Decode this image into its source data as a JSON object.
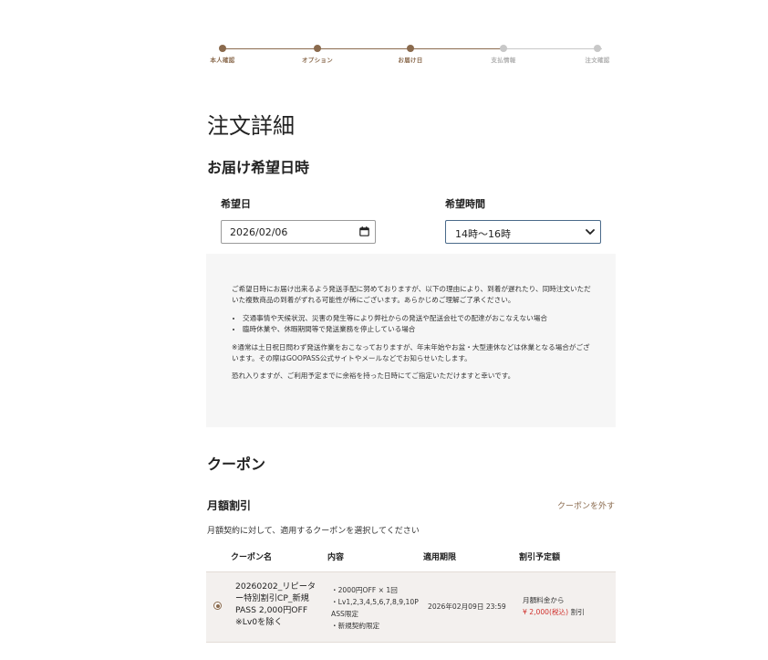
{
  "stepper": {
    "steps": [
      {
        "label": "本人確認",
        "done": true
      },
      {
        "label": "オプション",
        "done": true
      },
      {
        "label": "お届け日",
        "done": true
      },
      {
        "label": "支払情報",
        "done": false
      },
      {
        "label": "注文確認",
        "done": false
      }
    ]
  },
  "page_title": "注文詳細",
  "delivery": {
    "title": "お届け希望日時",
    "date_label": "希望日",
    "date_value": "2026/02/06",
    "time_label": "希望時間",
    "time_value": "14時〜16時"
  },
  "notice": {
    "para1": "ご希望日時にお届け出来るよう発送手配に努めておりますが、以下の理由により、到着が遅れたり、同時注文いただいた複数商品の到着がずれる可能性が稀にございます。あらかじめご理解ご了承ください。",
    "bullets": [
      "交通事情や天候状況、災害の発生等により弊社からの発送や配送会社での配達がおこなえない場合",
      "臨時休業や、休暇期間等で発送業務を停止している場合"
    ],
    "para2": "※通常は土日祝日問わず発送作業をおこなっておりますが、年末年始やお盆・大型連休などは休業となる場合がございます。その際はGOOPASS公式サイトやメールなどでお知らせいたします。",
    "para3": "恐れ入りますが、ご利用予定までに余裕を持った日時にてご指定いただけますと幸いです。"
  },
  "coupon": {
    "title": "クーポン",
    "monthly_title": "月額割引",
    "remove_label": "クーポンを外す",
    "description": "月額契約に対して、適用するクーポンを選択してください",
    "headers": [
      "クーポン名",
      "内容",
      "適用期限",
      "割引予定額"
    ],
    "rows": [
      {
        "name": "20260202_リピーター特別割引CP_新規PASS 2,000円OFF ※Lv0を除く",
        "content": "・2000円OFF × 1回\n・Lv1,2,3,4,5,6,7,8,9,10PASS限定\n・新規契約限定",
        "expiry": "2026年02月09日 23:59",
        "discount_prefix": "月額料金から",
        "discount_amount": "¥ 2,000(税込)",
        "discount_suffix": "割引"
      }
    ]
  },
  "colors": {
    "accent": "#8a6a4d",
    "inactive": "#c8c8c8",
    "red": "#d0312d"
  }
}
